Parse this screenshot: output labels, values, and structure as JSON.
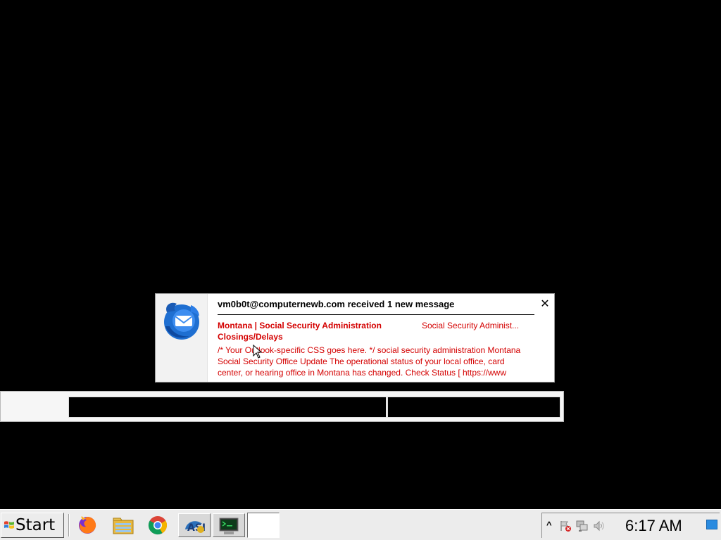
{
  "notification": {
    "header": "vm0b0t@computernewb.com received 1 new message",
    "close_glyph": "✕",
    "icon": "thunderbird-icon",
    "message": {
      "subject": "Montana | Social Security Administration Closings/Delays",
      "sender": "Social Security Administ...",
      "preview": "/* Your Outlook-specific CSS goes here. */ social security administration Montana Social Security Office Update The operational status of your local office, card center, or hearing office in Montana has changed. Check Status [ https://www"
    },
    "colors": {
      "message_text": "#d40000",
      "background": "#ffffff"
    }
  },
  "taskbar": {
    "start_label": "Start",
    "quick_launch": [
      "firefox-icon",
      "file-manager-icon",
      "chrome-icon",
      "kleopatra-icon",
      "terminal-icon"
    ],
    "tray": {
      "expand_glyph": "^",
      "icons": [
        "flag-error-icon",
        "network-icon",
        "volume-icon"
      ],
      "clock": "6:17 AM"
    }
  }
}
